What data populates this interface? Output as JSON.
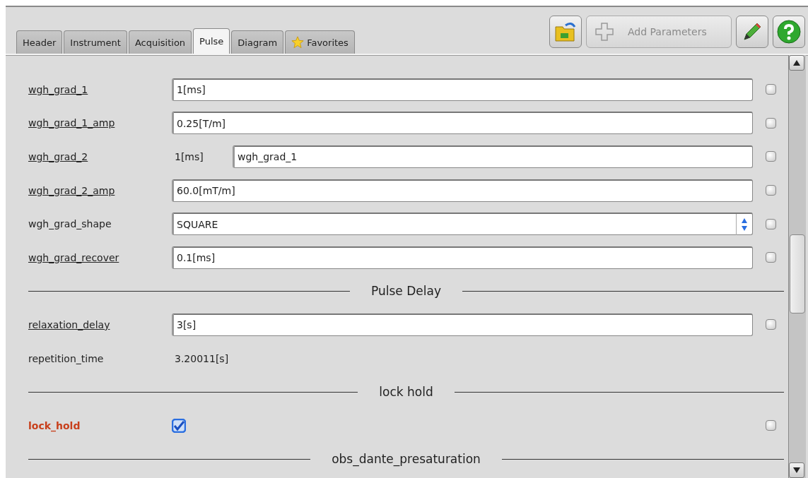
{
  "tabs": [
    {
      "label": "Header",
      "selected": false,
      "kind": "plain"
    },
    {
      "label": "Instrument",
      "selected": false,
      "kind": "plain"
    },
    {
      "label": "Acquisition",
      "selected": false,
      "kind": "plain"
    },
    {
      "label": "Pulse",
      "selected": true,
      "kind": "plain"
    },
    {
      "label": "Diagram",
      "selected": false,
      "kind": "plain"
    },
    {
      "label": "Favorites",
      "selected": false,
      "kind": "favorites"
    }
  ],
  "toolbar": {
    "add_parameters": {
      "label": "Add Parameters",
      "disabled": true
    }
  },
  "rows": [
    {
      "kind": "field",
      "label": "wgh_grad_1",
      "linked": true,
      "value": "1[ms]"
    },
    {
      "kind": "field",
      "label": "wgh_grad_1_amp",
      "linked": true,
      "value": "0.25[T/m]"
    },
    {
      "kind": "linked",
      "label": "wgh_grad_2",
      "linked": true,
      "reading": "1[ms]",
      "value": "wgh_grad_1"
    },
    {
      "kind": "field",
      "label": "wgh_grad_2_amp",
      "linked": true,
      "value": "60.0[mT/m]"
    },
    {
      "kind": "select",
      "label": "wgh_grad_shape",
      "linked": false,
      "value": "SQUARE"
    },
    {
      "kind": "field",
      "label": "wgh_grad_recover",
      "linked": true,
      "value": "0.1[ms]"
    },
    {
      "kind": "section",
      "label": "Pulse Delay"
    },
    {
      "kind": "field",
      "label": "relaxation_delay",
      "linked": true,
      "value": "3[s]"
    },
    {
      "kind": "readonly",
      "label": "repetition_time",
      "linked": false,
      "reading": "3.20011[s]"
    },
    {
      "kind": "section",
      "label": "lock hold"
    },
    {
      "kind": "checkbox",
      "label": "lock_hold",
      "linked": false,
      "highlighted": true,
      "checked": true
    },
    {
      "kind": "section",
      "label": "obs_dante_presaturation"
    }
  ]
}
